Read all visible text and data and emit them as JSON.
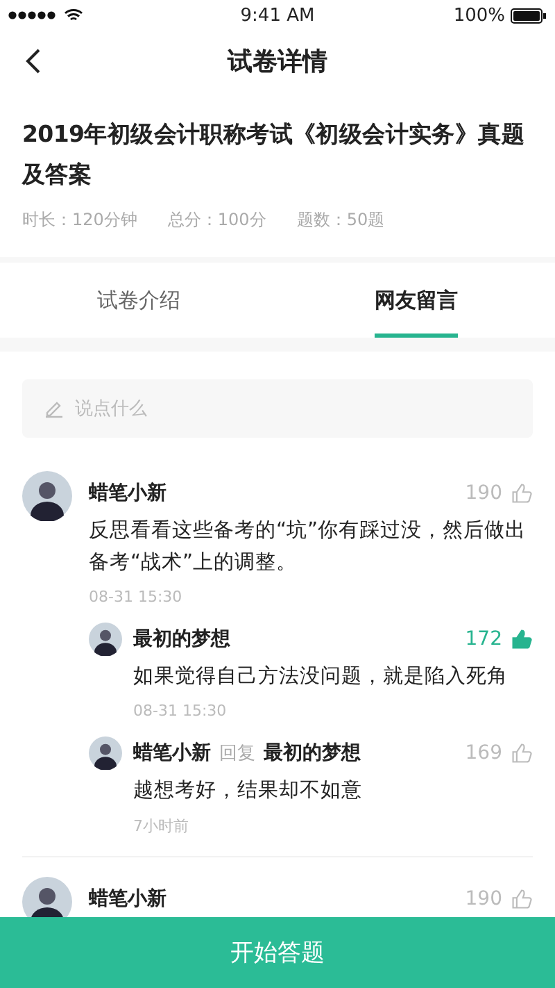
{
  "status_bar": {
    "time": "9:41 AM",
    "battery": "100%"
  },
  "nav": {
    "title": "试卷详情"
  },
  "paper": {
    "title": "2019年初级会计职称考试《初级会计实务》真题及答案",
    "meta": [
      "时长：120分钟",
      "总分：100分",
      "题数：50题"
    ]
  },
  "tabs": [
    {
      "label": "试卷介绍",
      "selected": false
    },
    {
      "label": "网友留言",
      "selected": true
    }
  ],
  "comment_input": {
    "placeholder": "说点什么"
  },
  "comments": [
    {
      "name": "蜡笔小新",
      "likes": "190",
      "liked": false,
      "text": "反思看看这些备考的“坑”你有踩过没，然后做出备考“战术”上的调整。",
      "time": "08-31 15:30",
      "replies": [
        {
          "name": "最初的梦想",
          "likes": "172",
          "liked": true,
          "text": "如果觉得自己方法没问题，就是陷入死角",
          "time": "08-31 15:30"
        },
        {
          "name": "蜡笔小新",
          "reply_word": "回复",
          "reply_to": "最初的梦想",
          "likes": "169",
          "liked": false,
          "text": "越想考好，结果却不如意",
          "time": "7小时前"
        }
      ]
    },
    {
      "name": "蜡笔小新",
      "likes": "190",
      "liked": false
    }
  ],
  "start_button": "开始答题"
}
